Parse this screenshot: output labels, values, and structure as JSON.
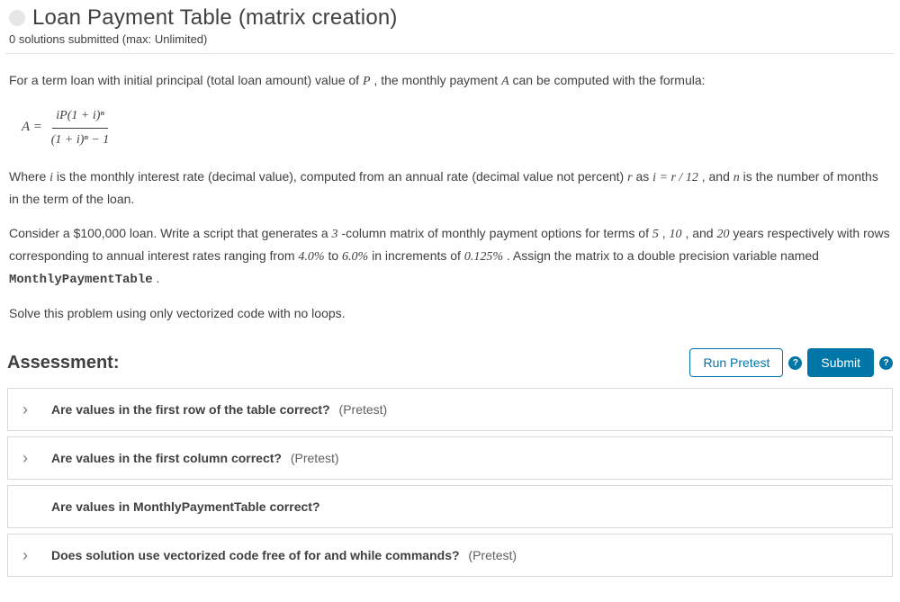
{
  "header": {
    "title": "Loan Payment Table (matrix creation)",
    "subtitle": "0 solutions submitted (max: Unlimited)"
  },
  "problem": {
    "intro_before_P": "For a term loan with initial principal (total loan amount) value of ",
    "var_P": "P",
    "intro_mid": ", the monthly payment ",
    "var_A": "A",
    "intro_after": " can be computed with the formula:",
    "formula": {
      "lhs": "A =",
      "num": "iP(1 + i)ⁿ",
      "den": "(1 + i)ⁿ − 1"
    },
    "where_1": "Where ",
    "var_i": "i",
    "where_2": " is the monthly interest rate (decimal value), computed from an annual rate (decimal value not percent) ",
    "var_r": "r",
    "where_3": " as ",
    "eq_i": "i = r / 12",
    "where_4": ", and ",
    "var_n": "n",
    "where_5": " is the number of months in the term of the loan.",
    "task_1a": "Consider a $100,000 loan. Write a script that generates a ",
    "three": "3",
    "task_1b": "-column matrix of monthly payment options for terms of ",
    "five": "5",
    "task_1c": ", ",
    "ten": "10",
    "task_1d": ", and ",
    "twenty": "20",
    "task_1e": " years respectively with rows corresponding to annual interest rates ranging from ",
    "pct_lo": "4.0%",
    "task_1f": " to ",
    "pct_hi": "6.0%",
    "task_1g": " in increments of ",
    "pct_step": "0.125%",
    "task_1h": ". Assign the matrix to a double precision variable named ",
    "varname": "MonthlyPaymentTable",
    "task_1i": ".",
    "task_2": "Solve this problem using only vectorized code with no loops."
  },
  "assessment": {
    "heading": "Assessment:",
    "run_pretest": "Run Pretest",
    "submit": "Submit",
    "help_glyph": "?",
    "items": [
      {
        "q": "Are values in the first row of the table correct?",
        "tag": "(Pretest)",
        "expandable": true
      },
      {
        "q": "Are values in the first column correct?",
        "tag": "(Pretest)",
        "expandable": true
      },
      {
        "q": "Are values in MonthlyPaymentTable correct?",
        "tag": "",
        "expandable": false
      },
      {
        "q": "Does solution use vectorized code free of for and while commands?",
        "tag": "(Pretest)",
        "expandable": true
      }
    ]
  }
}
